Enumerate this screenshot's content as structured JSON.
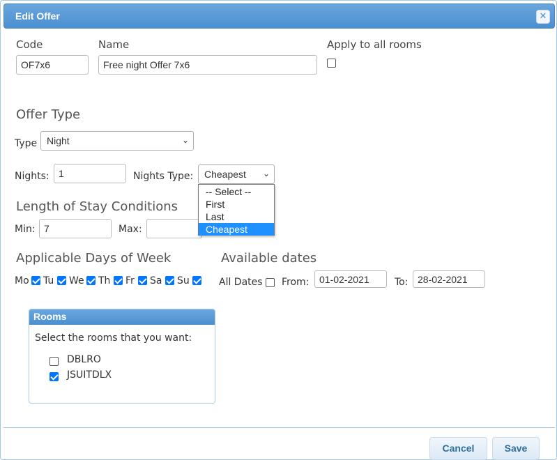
{
  "dialog": {
    "title": "Edit Offer",
    "close_symbol": "✕"
  },
  "code": {
    "label": "Code",
    "value": "OF7x6"
  },
  "name": {
    "label": "Name",
    "value": "Free night Offer 7x6"
  },
  "apply_all": {
    "label": "Apply to all rooms",
    "checked": false
  },
  "offer_type": {
    "heading": "Offer Type",
    "type_label": "Type",
    "type_value": "Night",
    "nights_label": "Nights:",
    "nights_value": "1",
    "nights_type_label": "Nights Type:",
    "nights_type_value": "Cheapest",
    "nights_type_options": [
      "-- Select --",
      "First",
      "Last",
      "Cheapest"
    ],
    "nights_type_selected_index": 3
  },
  "length_of_stay": {
    "heading": "Length of Stay Conditions",
    "min_label": "Min:",
    "min_value": "7",
    "max_label": "Max:",
    "max_value": ""
  },
  "days_of_week": {
    "heading": "Applicable Days of Week",
    "days": [
      {
        "label": "Mo",
        "checked": true
      },
      {
        "label": "Tu",
        "checked": true
      },
      {
        "label": "We",
        "checked": true
      },
      {
        "label": "Th",
        "checked": true
      },
      {
        "label": "Fr",
        "checked": true
      },
      {
        "label": "Sa",
        "checked": true
      },
      {
        "label": "Su",
        "checked": true
      }
    ]
  },
  "available_dates": {
    "heading": "Available dates",
    "all_dates_label": "All Dates",
    "all_dates_checked": false,
    "from_label": "From:",
    "from_value": "01-02-2021",
    "to_label": "To:",
    "to_value": "28-02-2021"
  },
  "rooms": {
    "header": "Rooms",
    "instruction": "Select the rooms that you want:",
    "items": [
      {
        "label": "DBLRO",
        "checked": false
      },
      {
        "label": "JSUITDLX",
        "checked": true
      }
    ]
  },
  "footer": {
    "cancel_label": "Cancel",
    "save_label": "Save"
  },
  "colors": {
    "accent": "#4b8fd0",
    "checkbox_checked": "#0075ff",
    "dropdown_highlight": "#1e90ff"
  }
}
